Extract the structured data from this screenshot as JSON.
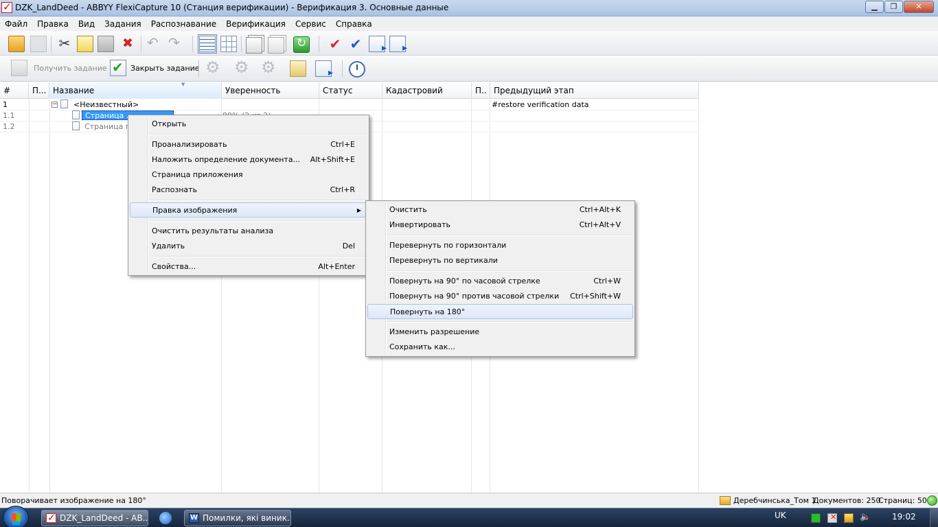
{
  "window": {
    "title": "DZK_LandDeed - ABBYY FlexiCapture 10 (Станция верификации) - Верификация 3. Основные данные",
    "controls": [
      "minimize",
      "maximize",
      "close"
    ]
  },
  "menubar": [
    "Файл",
    "Правка",
    "Вид",
    "Задания",
    "Распознавание",
    "Верификация",
    "Сервис",
    "Справка"
  ],
  "toolbar2": {
    "get_task_label": "Получить задание",
    "close_task_label": "Закрыть задание"
  },
  "grid": {
    "columns": [
      "#",
      "П...",
      "Название",
      "Уверенность",
      "Статус",
      "Кадастровий",
      "П..",
      "Предыдущий этап"
    ],
    "sorted_column": "Название",
    "rows": [
      {
        "num": "1",
        "name": "<Неизвестный>",
        "confidence": "",
        "prev_stage": "#restore verification data"
      },
      {
        "num": "1.1",
        "name": "Страница ...",
        "confidence": "99% (2 из 2)",
        "prev_stage": ""
      },
      {
        "num": "1.2",
        "name": "Страница п",
        "confidence": "",
        "prev_stage": ""
      }
    ]
  },
  "context_menu": {
    "items": [
      {
        "label": "Открыть",
        "shortcut": ""
      },
      {
        "label": "Проанализировать",
        "shortcut": "Ctrl+E"
      },
      {
        "label": "Наложить определение документа...",
        "shortcut": "Alt+Shift+E"
      },
      {
        "label": "Страница приложения",
        "shortcut": ""
      },
      {
        "label": "Распознать",
        "shortcut": "Ctrl+R"
      },
      {
        "label": "Правка изображения",
        "shortcut": "",
        "has_submenu": true
      },
      {
        "label": "Очистить результаты анализа",
        "shortcut": ""
      },
      {
        "label": "Удалить",
        "shortcut": "Del"
      },
      {
        "label": "Свойства...",
        "shortcut": "Alt+Enter"
      }
    ],
    "hovered_item": "Правка изображения"
  },
  "submenu": {
    "items": [
      {
        "label": "Очистить",
        "shortcut": "Ctrl+Alt+K"
      },
      {
        "label": "Инвертировать",
        "shortcut": "Ctrl+Alt+V"
      },
      {
        "label": "Перевернуть по горизонтали",
        "shortcut": ""
      },
      {
        "label": "Перевернуть по вертикали",
        "shortcut": ""
      },
      {
        "label": "Повернуть на 90° по часовой стрелке",
        "shortcut": "Ctrl+W"
      },
      {
        "label": "Повернуть на 90° против часовой стрелки",
        "shortcut": "Ctrl+Shift+W"
      },
      {
        "label": "Повернуть на 180°",
        "shortcut": ""
      },
      {
        "label": "Изменить разрешение",
        "shortcut": ""
      },
      {
        "label": "Сохранить как...",
        "shortcut": ""
      }
    ],
    "hovered_item": "Повернуть на 180°"
  },
  "statusbar": {
    "hint": "Поворачивает изображение на 180°",
    "batch": "Деребчинська_Том 1",
    "documents": "Документов: 250",
    "pages": "Страниц: 500"
  },
  "taskbar": {
    "buttons": [
      "DZK_LandDeed - AB...",
      "Помилки, які виник..."
    ],
    "language": "UK",
    "clock": "19:02"
  },
  "icons": {
    "toolbar1": [
      "open-batch-icon",
      "save-icon",
      "cut-icon",
      "copy-icon",
      "paste-icon",
      "delete-icon",
      "undo-icon",
      "redo-icon",
      "list-view-icon",
      "thumbnail-view-icon",
      "pages-icon",
      "print-pages-icon",
      "refresh-icon",
      "verify-icon",
      "verify-all-icon",
      "export-doc-icon",
      "import-doc-icon"
    ],
    "toolbar2": [
      "get-task-icon",
      "close-task-icon",
      "settings-gear-icon",
      "batch-gear-icon",
      "recognize-icon",
      "lock-icon",
      "send-icon",
      "timer-icon"
    ]
  },
  "colors": {
    "selection": "#3399ff",
    "menu_hover": "#dce8f8",
    "taskbar": "#1d2f4b"
  }
}
